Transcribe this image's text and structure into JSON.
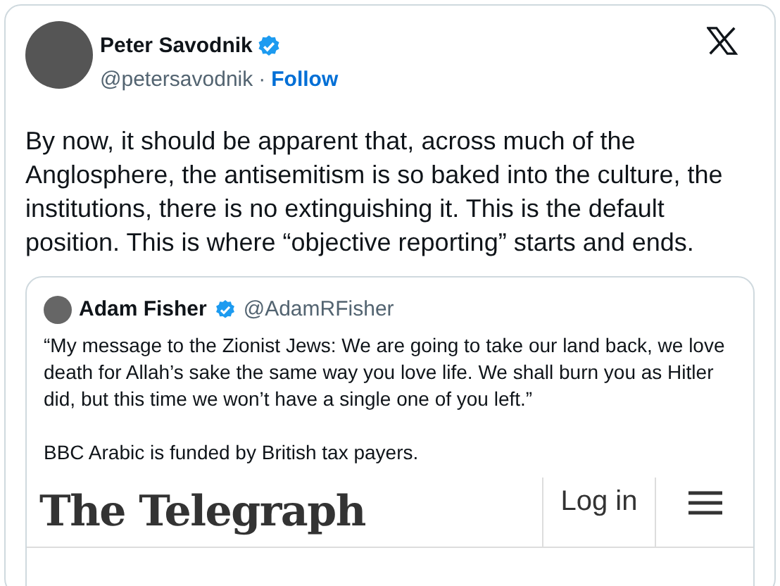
{
  "author": {
    "name": "Peter Savodnik",
    "handle": "@petersavodnik",
    "separator": "·",
    "follow": "Follow",
    "verified": true
  },
  "text": "By now, it should be apparent that, across much of the Anglosphere, the antisemitism is so baked into the culture, the institutions, there is no extinguishing it. This is the default position. This is where “objective reporting” starts and ends.",
  "quoted": {
    "author": {
      "name": "Adam Fisher",
      "handle": "@AdamRFisher",
      "verified": true
    },
    "paragraphs": [
      "“My message to the Zionist Jews: We are going to take our land back, we love death for Allah’s sake the same way you love life. We shall burn you as Hitler did, but this time we won’t have a single one of you left.”",
      "BBC Arabic is funded by British tax payers."
    ],
    "image": {
      "logo": "The Telegraph",
      "login": "Log in"
    }
  }
}
